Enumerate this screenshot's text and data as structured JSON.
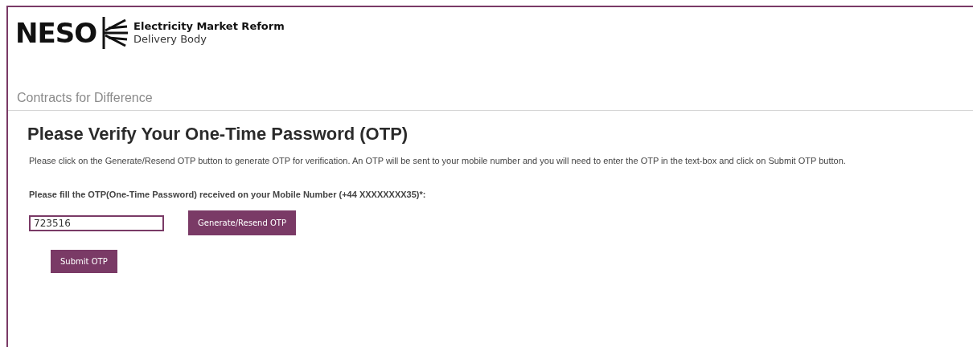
{
  "header": {
    "logo_text": "NESO",
    "org_line_1": "Electricity Market Reform",
    "org_line_2": "Delivery Body"
  },
  "section_title": "Contracts for Difference",
  "page_title": "Please Verify Your One-Time Password (OTP)",
  "instructions": "Please click on the Generate/Resend OTP button to generate OTP for verification. An OTP will be sent to your mobile number and you will need to enter the OTP in the text-box and click on Submit OTP button.",
  "otp_field": {
    "label": "Please fill the OTP(One-Time Password) received on your Mobile Number (+44 XXXXXXXX35)*:",
    "value": "723516"
  },
  "buttons": [
    {
      "kind": "generate",
      "label": "Generate/Resend OTP"
    },
    {
      "kind": "submit",
      "label": "Submit OTP"
    }
  ]
}
